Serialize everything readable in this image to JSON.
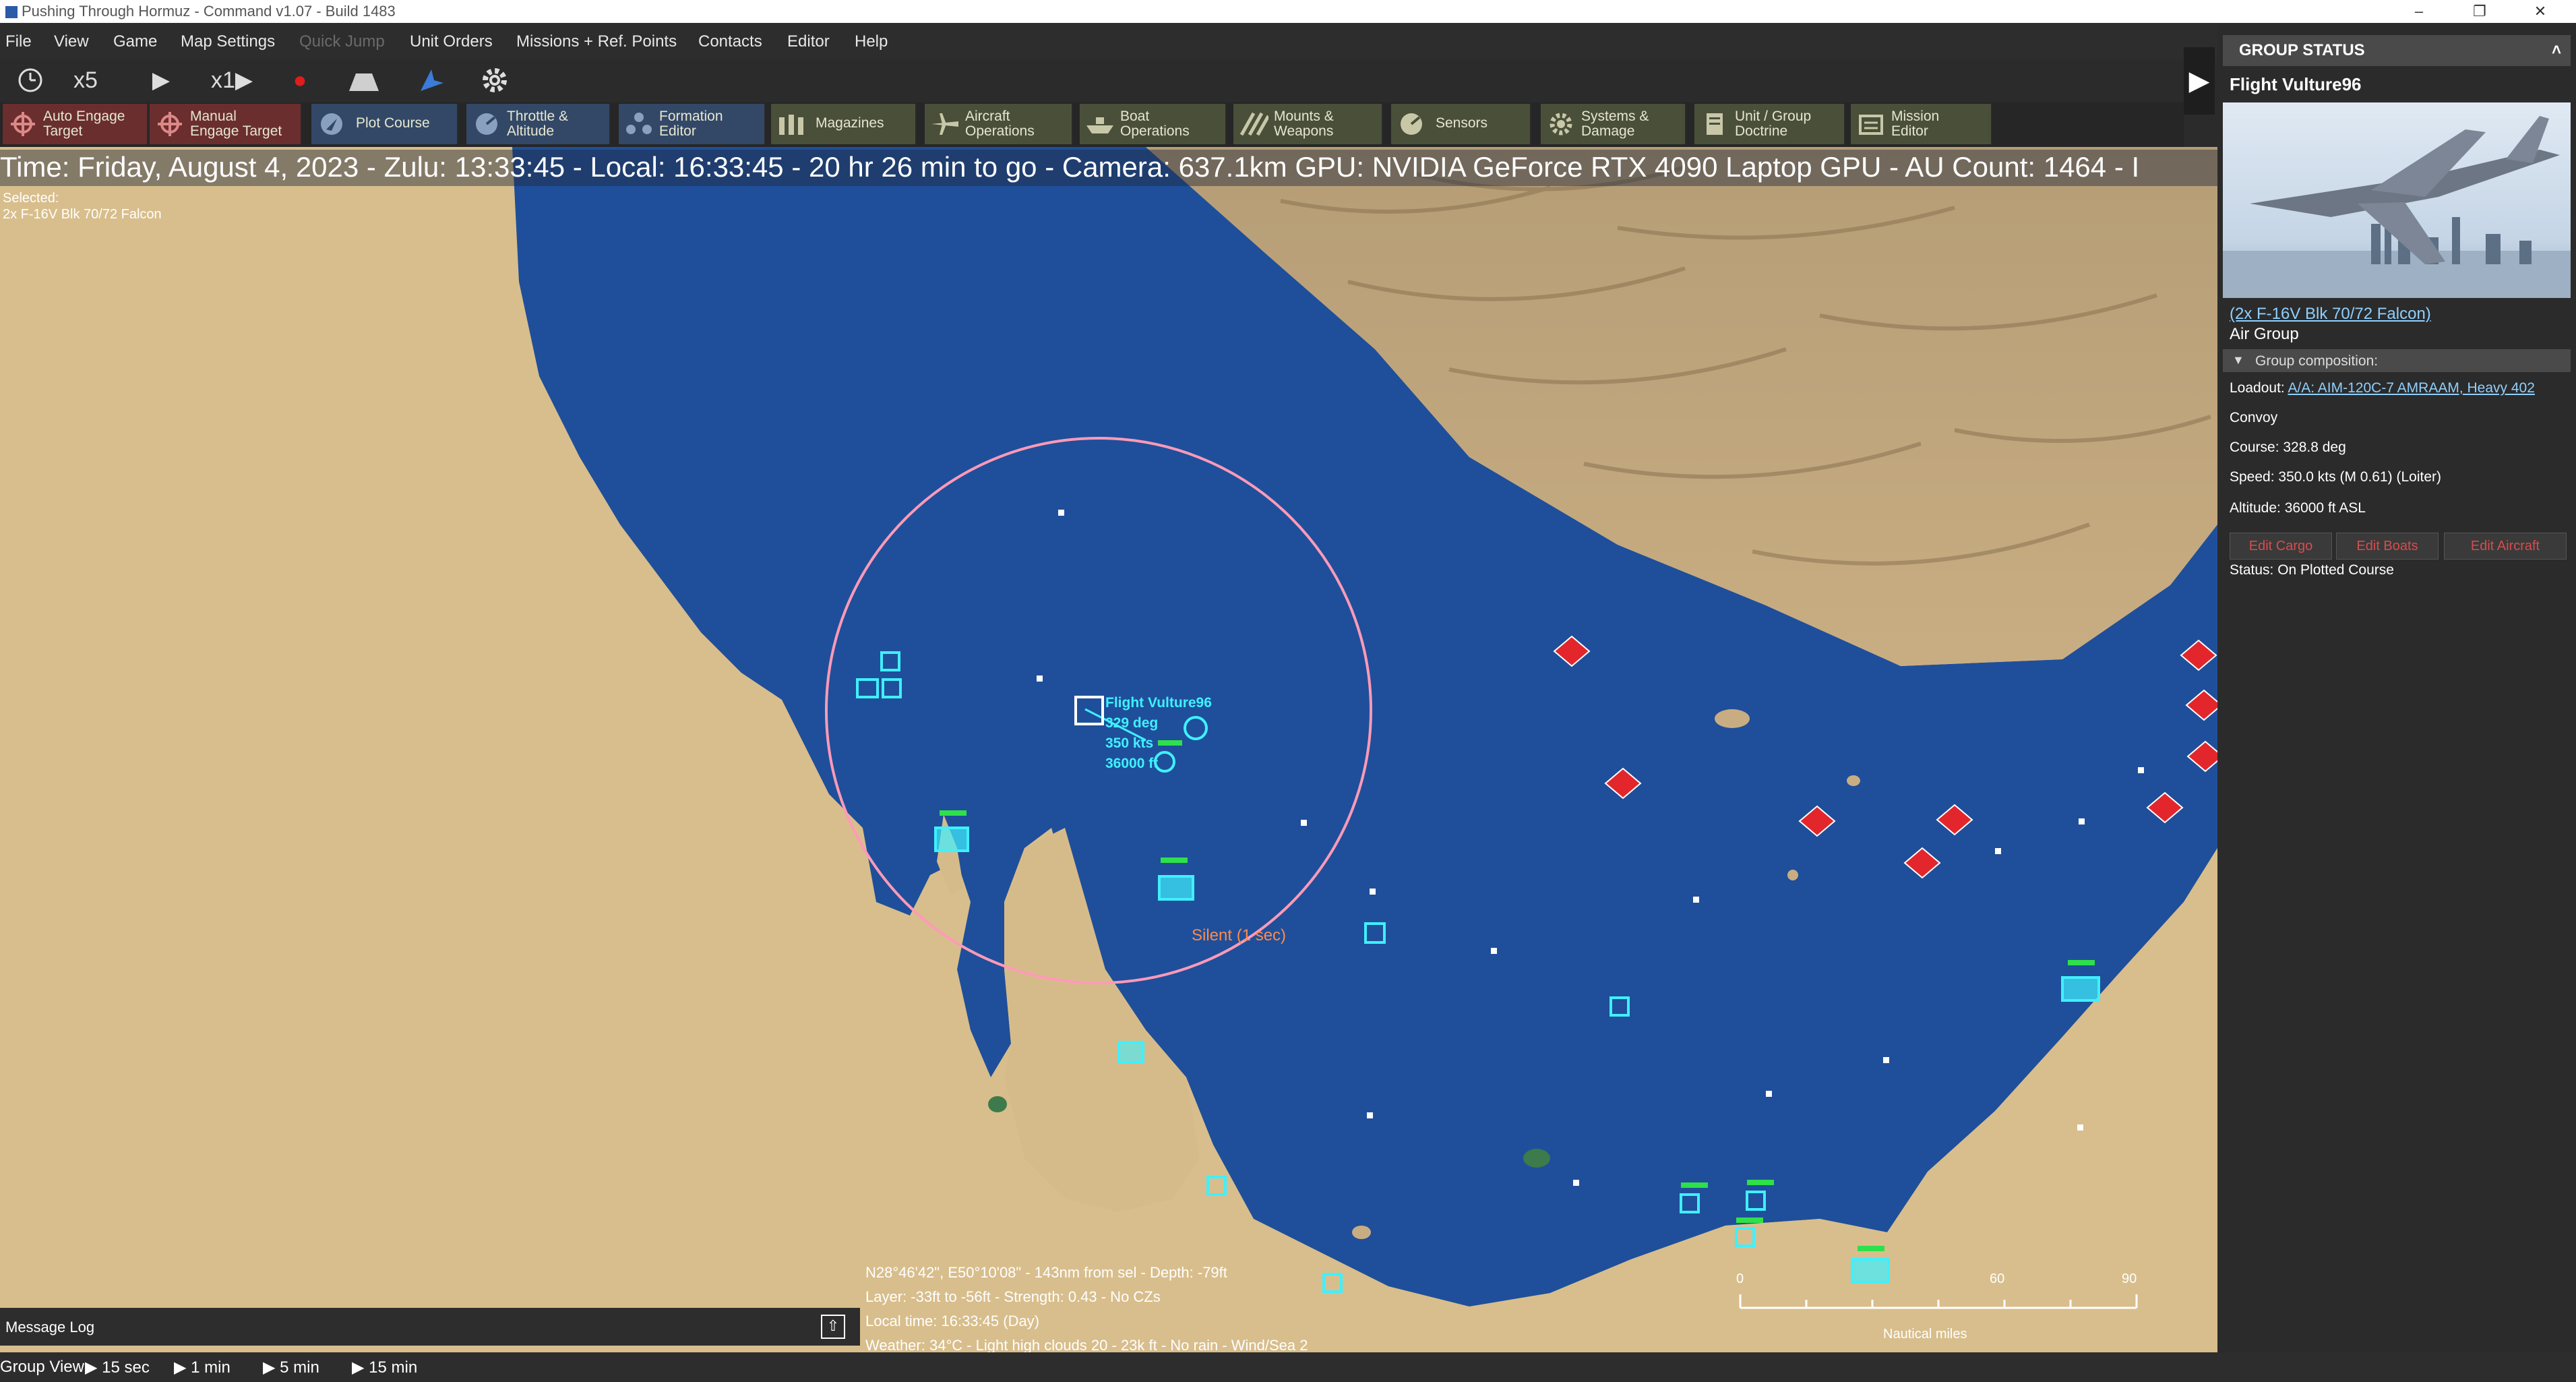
{
  "window": {
    "title": "Pushing Through Hormuz - Command v1.07 - Build 1483"
  },
  "menu": [
    "File",
    "View",
    "Game",
    "Map Settings",
    "Quick Jump",
    "Unit Orders",
    "Missions + Ref. Points",
    "Contacts",
    "Editor",
    "Help"
  ],
  "menu_disabled": [
    "Quick Jump"
  ],
  "time_controls": {
    "compression": "x5",
    "step": "x1"
  },
  "toolbar": [
    {
      "l1": "Auto Engage",
      "l2": "Target",
      "icon": "target-icon"
    },
    {
      "l1": "Manual",
      "l2": "Engage Target",
      "icon": "target-icon"
    },
    {
      "l1": "Plot Course",
      "l2": "",
      "icon": "course-icon"
    },
    {
      "l1": "Throttle &",
      "l2": "Altitude",
      "icon": "throttle-icon"
    },
    {
      "l1": "Formation",
      "l2": "Editor",
      "icon": "formation-icon"
    },
    {
      "l1": "Magazines",
      "l2": "",
      "icon": "magazine-icon"
    },
    {
      "l1": "Aircraft",
      "l2": "Operations",
      "icon": "aircraft-icon"
    },
    {
      "l1": "Boat",
      "l2": "Operations",
      "icon": "boat-icon"
    },
    {
      "l1": "Mounts &",
      "l2": "Weapons",
      "icon": "weapons-icon"
    },
    {
      "l1": "Sensors",
      "l2": "",
      "icon": "sensor-icon"
    },
    {
      "l1": "Systems &",
      "l2": "Damage",
      "icon": "gear-icon"
    },
    {
      "l1": "Unit / Group",
      "l2": "Doctrine",
      "icon": "doctrine-icon"
    },
    {
      "l1": "Mission",
      "l2": "Editor",
      "icon": "mission-icon"
    }
  ],
  "map": {
    "status_line": "Time: Friday, August 4, 2023 - Zulu: 13:33:45 - Local: 16:33:45 - 20 hr 26 min to go - Camera: 637.1km GPU: NVIDIA GeForce RTX 4090 Laptop GPU - AU Count: 1464 - I",
    "selected_label": "Selected:",
    "selected_unit": "2x F-16V Blk 70/72 Falcon",
    "flight_name": "Flight Vulture96",
    "flight_course": "329 deg",
    "flight_speed": "350 kts",
    "flight_alt": "36000 ft",
    "emcon": "Silent (1 sec)",
    "cursor_lines": [
      "N28°46'42\", E50°10'08\" - 143nm from sel - Depth: -79ft",
      "Layer: -33ft to -56ft - Strength: 0.43 - No CZs",
      "Local time: 16:33:45 (Day)",
      "Weather: 34°C - Light high clouds 20 - 23k ft - No rain - Wind/Sea 2"
    ],
    "scale_ticks": [
      "0",
      "60",
      "90"
    ],
    "scale_unit": "Nautical miles"
  },
  "bottom": {
    "message_log": "Message Log",
    "group_view": "Group View",
    "steps": [
      "15 sec",
      "1 min",
      "5 min",
      "15 min"
    ]
  },
  "group_status": {
    "header": "GROUP STATUS",
    "name": "Flight Vulture96",
    "unit_link": "(2x F-16V Blk 70/72 Falcon)",
    "type": "Air Group",
    "composition": "Group composition:",
    "loadout_label": "Loadout:",
    "loadout_value": "A/A: AIM-120C-7 AMRAAM, Heavy 402",
    "convoy": "Convoy",
    "course": "Course: 328.8 deg",
    "speed": "Speed: 350.0 kts (M 0.61) (Loiter)",
    "altitude": "Altitude: 36000 ft ASL",
    "buttons": [
      "Edit Cargo",
      "Edit Boats",
      "Edit Aircraft"
    ],
    "status": "Status: On Plotted Course"
  },
  "colors": {
    "sea": "#1f4f9a",
    "friendly": "#3ff0ff",
    "hostile": "#e3262c",
    "range_ring": "#ff9ab8"
  }
}
